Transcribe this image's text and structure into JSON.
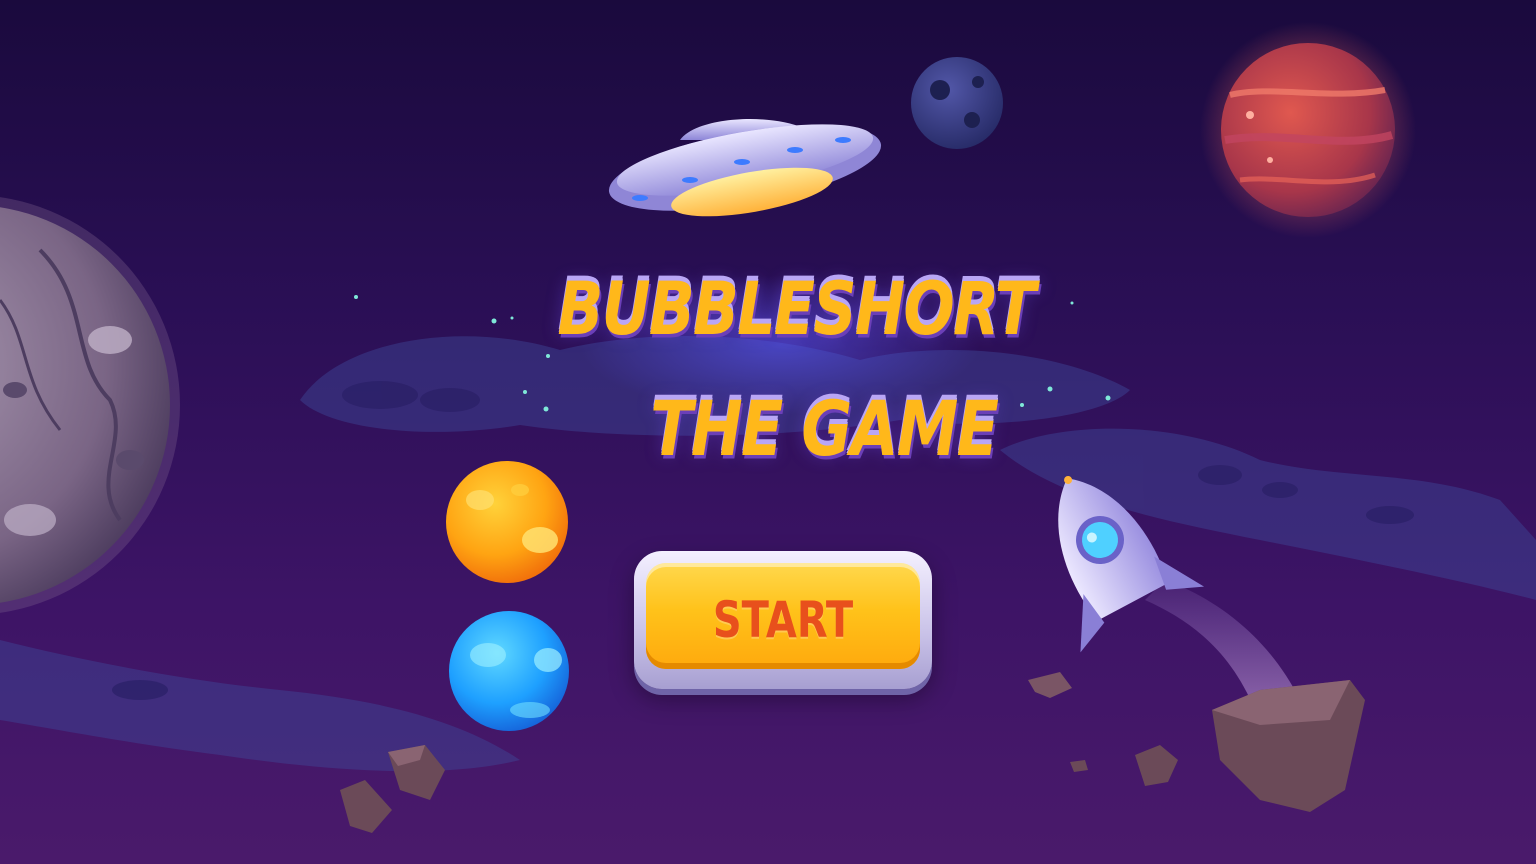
{
  "game": {
    "title_line_1": "BUBBLESHORT",
    "title_line_2": "THE GAME",
    "start_label": "START"
  },
  "colors": {
    "background_top": "#1a0a3d",
    "background_bottom": "#4a1a6b",
    "title_fill": "#ffb81a",
    "title_outline": "#b9a6f5",
    "button_fill": "#ffc21a",
    "button_text": "#e8501c"
  },
  "icons": [
    "ufo-icon",
    "moon-icon",
    "red-planet-icon",
    "gray-planet-icon",
    "orange-bubble-icon",
    "blue-bubble-icon",
    "rocket-icon",
    "asteroid-icon"
  ]
}
